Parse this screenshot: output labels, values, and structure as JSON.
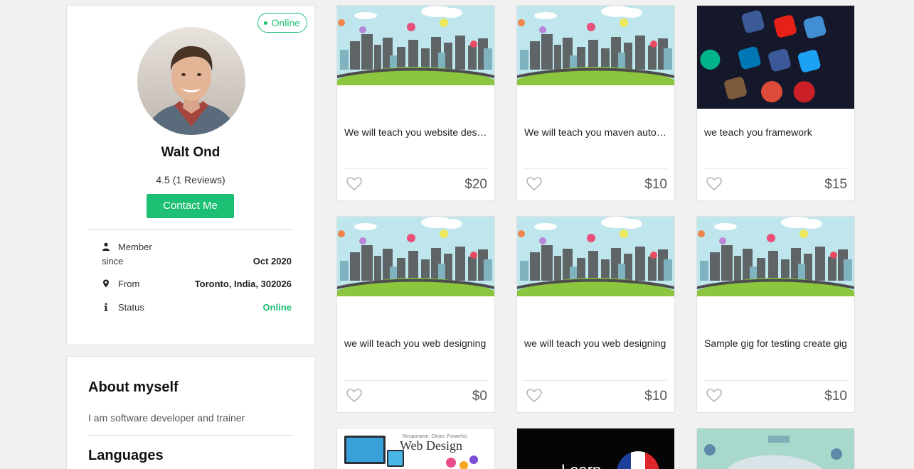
{
  "profile": {
    "status_badge": "Online",
    "name": "Walt Ond",
    "rating": "4.5 (1 Reviews)",
    "contact_label": "Contact Me",
    "member_label_1": "Member",
    "member_label_2": "since",
    "member_value": "Oct 2020",
    "from_label": "From",
    "from_value": "Toronto, India, 302026",
    "status_label": "Status",
    "status_value": "Online"
  },
  "about": {
    "title": "About myself",
    "text": "I am software developer and trainer",
    "languages_title": "Languages"
  },
  "gigs": [
    {
      "title": "We will teach you website designing",
      "price": "$20",
      "image": "city-illustration"
    },
    {
      "title": "We will teach you maven automation",
      "price": "$10",
      "image": "city-illustration"
    },
    {
      "title": "we teach you framework",
      "price": "$15",
      "image": "social-apps-phone"
    },
    {
      "title": "we will teach you web designing",
      "price": "$0",
      "image": "city-illustration"
    },
    {
      "title": "we will teach you web designing",
      "price": "$10",
      "image": "city-illustration"
    },
    {
      "title": "Sample gig for testing create gig",
      "price": "$10",
      "image": "city-illustration"
    }
  ],
  "partial_gigs": {
    "web_design_caption": "Responsive. Clean. Powerful.",
    "web_design_title": "Web Design",
    "learn_text": "Learn"
  },
  "colors": {
    "accent_green": "#1dbf73",
    "page_bg": "#f1f1f1"
  }
}
